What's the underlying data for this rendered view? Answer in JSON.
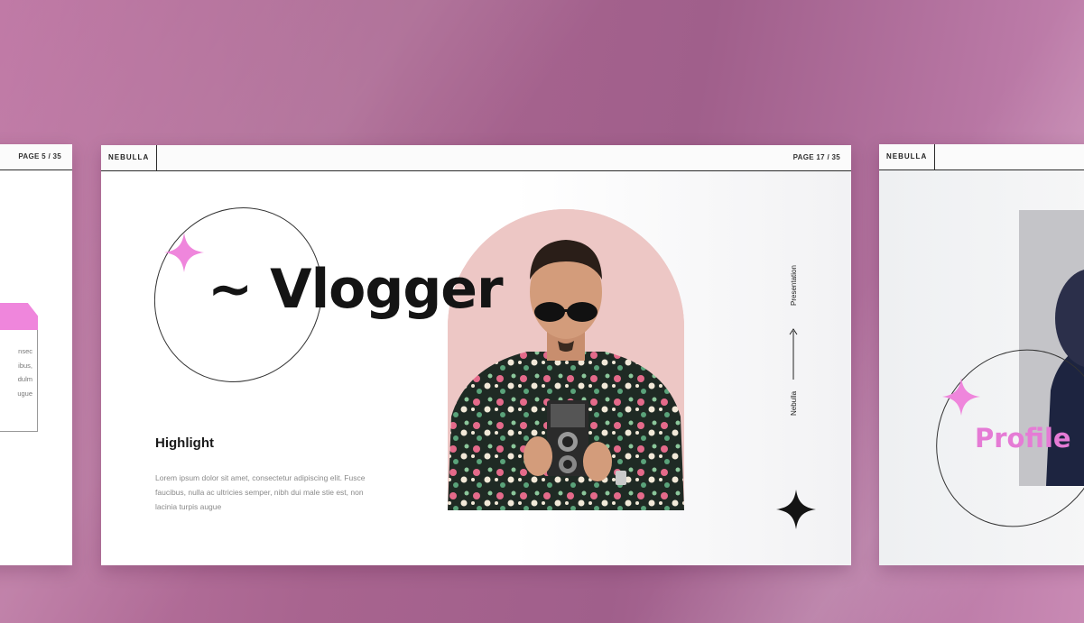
{
  "colors": {
    "accent_pink": "#ef86dc",
    "background": "#a8648f",
    "text_dark": "#141414"
  },
  "left_slide": {
    "page_label": "PAGE 5 / 35",
    "text_lines": [
      "nsec",
      "ibus,",
      "dulm",
      "ugue"
    ]
  },
  "main_slide": {
    "brand": "NEBULLA",
    "page_label": "PAGE 17 / 35",
    "title": "~ Vlogger",
    "heading": "Highlight",
    "body": "Lorem ipsum dolor sit amet, consectetur adipiscing elit. Fusce faucibus, nulla ac ultricies semper, nibh dui male stie est, non lacinia turpis augue",
    "vertical_top": "Presentation",
    "vertical_bottom": "Nebulla",
    "icons": [
      "sparkle-pink-icon",
      "sparkle-black-icon",
      "arrow-up-icon"
    ]
  },
  "right_slide": {
    "brand": "NEBULLA",
    "title": "Profile",
    "icons": [
      "sparkle-pink-icon"
    ]
  }
}
